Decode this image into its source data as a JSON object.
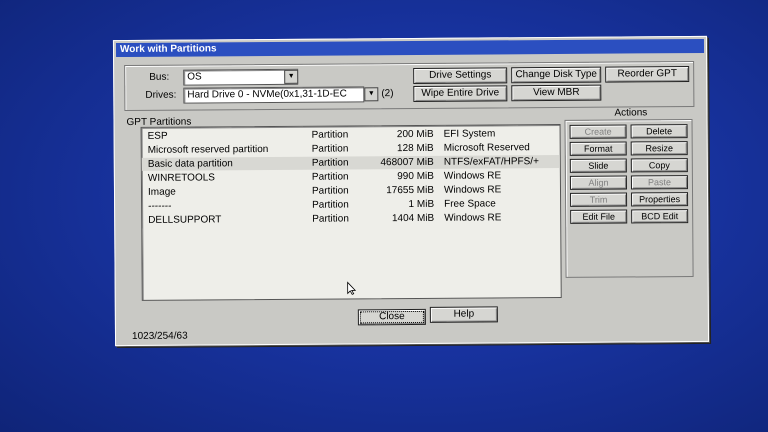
{
  "dialog": {
    "title": "Work with Partitions"
  },
  "bus": {
    "label": "Bus:",
    "value": "OS"
  },
  "drives": {
    "label": "Drives:",
    "value": "Hard Drive 0 - NVMe(0x1,31-1D-EC",
    "count": "(2)"
  },
  "top_buttons": {
    "drive_settings": "Drive Settings",
    "change_disk_type": "Change Disk Type",
    "reorder_gpt": "Reorder GPT",
    "wipe_entire_drive": "Wipe Entire Drive",
    "view_mbr": "View MBR"
  },
  "partitions": {
    "label": "GPT Partitions",
    "rows": [
      {
        "name": "ESP",
        "type": "Partition",
        "size": "200 MiB",
        "fs": "EFI System"
      },
      {
        "name": "Microsoft reserved partition",
        "type": "Partition",
        "size": "128 MiB",
        "fs": "Microsoft Reserved"
      },
      {
        "name": "Basic data partition",
        "type": "Partition",
        "size": "468007 MiB",
        "fs": "NTFS/exFAT/HPFS/+"
      },
      {
        "name": "WINRETOOLS",
        "type": "Partition",
        "size": "990 MiB",
        "fs": "Windows RE"
      },
      {
        "name": "Image",
        "type": "Partition",
        "size": "17655 MiB",
        "fs": "Windows RE"
      },
      {
        "name": "-------",
        "type": "Partition",
        "size": "1 MiB",
        "fs": "Free Space"
      },
      {
        "name": "DELLSUPPORT",
        "type": "Partition",
        "size": "1404 MiB",
        "fs": "Windows RE"
      }
    ]
  },
  "actions": {
    "label": "Actions",
    "create": "Create",
    "delete": "Delete",
    "format": "Format",
    "resize": "Resize",
    "slide": "Slide",
    "copy": "Copy",
    "align": "Align",
    "paste": "Paste",
    "trim": "Trim",
    "properties": "Properties",
    "edit_file": "Edit File",
    "bcd_edit": "BCD Edit"
  },
  "footer": {
    "close": "Close",
    "help": "Help",
    "status": "1023/254/63"
  },
  "colors": {
    "desktop": "#1833a0",
    "titlebar": "#2b4fc0",
    "dialog": "#c9c9c5"
  }
}
